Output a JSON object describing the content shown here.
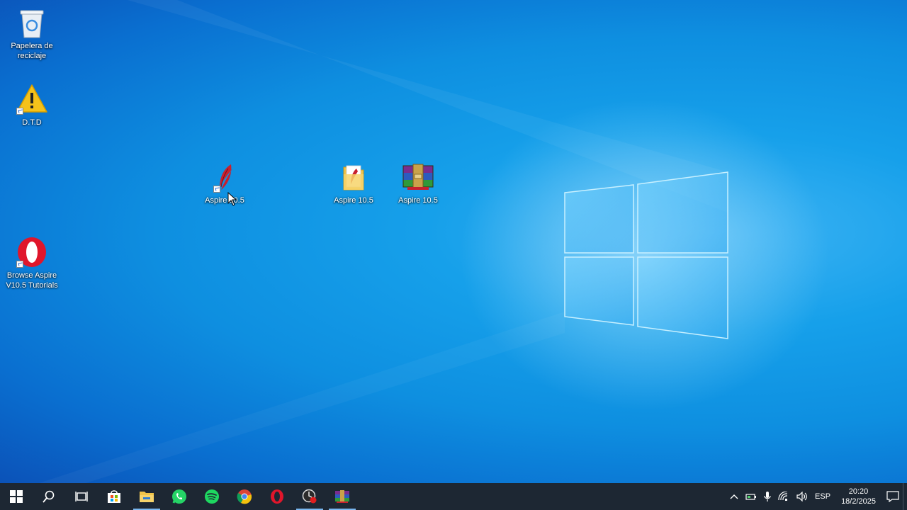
{
  "desktop": {
    "icons": [
      {
        "label": "Papelera de\nreciclaje",
        "icon": "recycle-bin-icon"
      },
      {
        "label": "D.T.D",
        "icon": "warning-icon"
      },
      {
        "label": "Aspire 10.5",
        "icon": "aspire-feather-icon"
      },
      {
        "label": "Aspire 10.5",
        "icon": "folder-icon"
      },
      {
        "label": "Aspire 10.5",
        "icon": "winrar-icon"
      },
      {
        "label": "Browse Aspire\nV10.5 Tutorials",
        "icon": "opera-icon"
      }
    ]
  },
  "taskbar": {
    "buttons": [
      "start-icon",
      "search-icon",
      "task-view-icon",
      "store-icon",
      "file-explorer-icon",
      "whatsapp-icon",
      "spotify-icon",
      "chrome-icon",
      "opera-icon",
      "recorder-icon",
      "winrar-icon"
    ]
  },
  "tray": {
    "language": "ESP",
    "time": "20:20",
    "date": "18/2/2025"
  },
  "colors": {
    "taskbar_bg": "#1d2733",
    "desktop_accent": "#16a0ea"
  }
}
